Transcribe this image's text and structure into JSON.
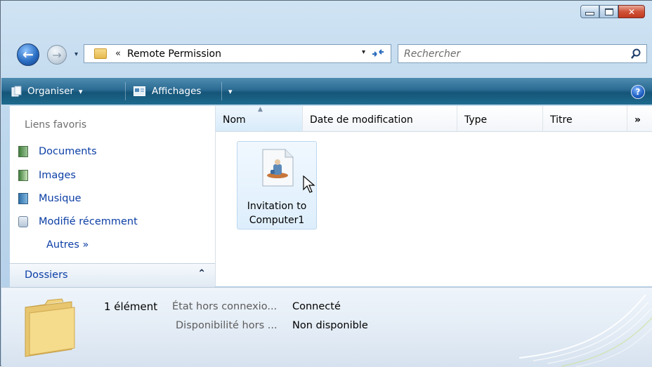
{
  "window": {
    "caption": {
      "minimize": "minimize",
      "maximize": "maximize",
      "close": "close"
    }
  },
  "address_bar": {
    "breadcrumb_chevron": "«",
    "path": "Remote Permission",
    "dropdown_glyph": "▾",
    "refresh_glyph": "⟳"
  },
  "search": {
    "placeholder": "Rechercher"
  },
  "toolbar": {
    "organize_label": "Organiser",
    "views_label": "Affichages",
    "dropdown_glyph": "▾",
    "help_glyph": "?"
  },
  "nav_pane": {
    "favorites_title": "Liens favoris",
    "items": [
      {
        "label": "Documents",
        "icon": "documents-icon"
      },
      {
        "label": "Images",
        "icon": "pictures-icon"
      },
      {
        "label": "Musique",
        "icon": "music-icon"
      },
      {
        "label": "Modifié récemment",
        "icon": "recent-icon"
      }
    ],
    "more_label": "Autres »",
    "folders_label": "Dossiers",
    "folders_chevron": "⌃"
  },
  "file_list": {
    "columns": [
      "Nom",
      "Date de modification",
      "Type",
      "Titre"
    ],
    "more_columns": "»",
    "items": [
      {
        "name_line1": "Invitation to",
        "name_line2": "Computer1",
        "icon": "remote-assistance-file-icon"
      }
    ]
  },
  "details": {
    "item_count": "1 élément",
    "rows": [
      {
        "label": "État hors connexio...",
        "value": "Connecté"
      },
      {
        "label": "Disponibilité hors ...",
        "value": "Non disponible"
      }
    ]
  },
  "colors": {
    "toolbar": "#1e6b8f",
    "link": "#0b3ea5",
    "selection": "#ddeefc"
  }
}
